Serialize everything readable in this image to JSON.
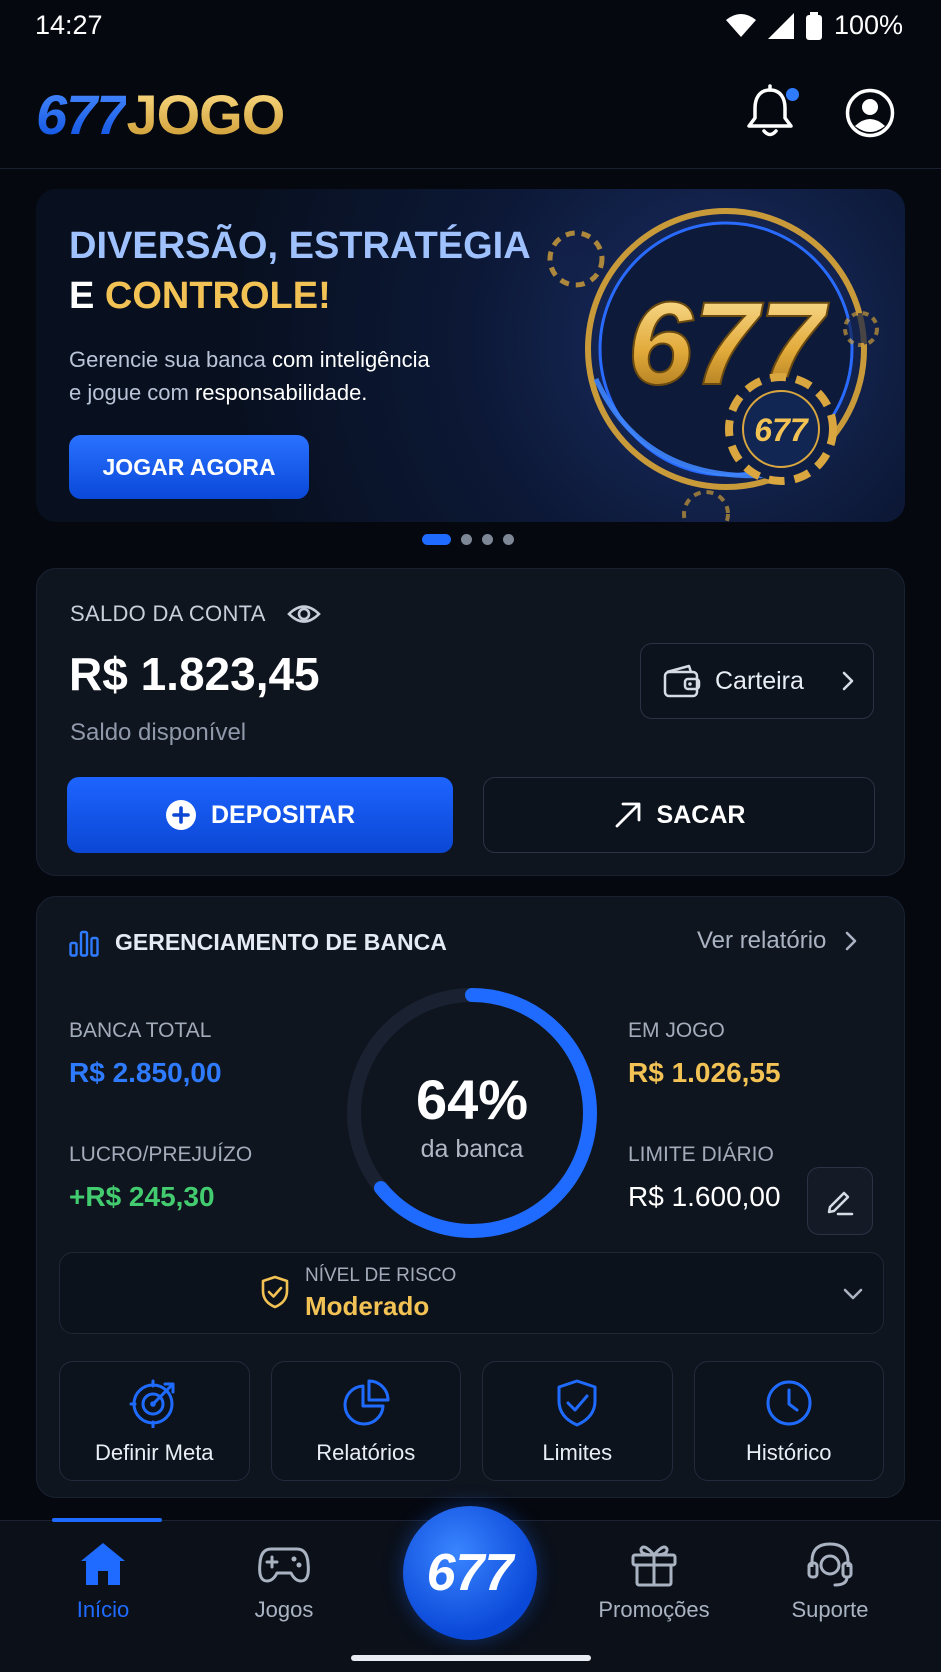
{
  "status_bar": {
    "time": "14:27",
    "battery": "100%"
  },
  "header": {
    "logo_number": "677",
    "logo_text": "JOGO",
    "has_notification": true
  },
  "hero": {
    "title_line1": "DIVERSÃO, ESTRATÉGIA",
    "title_line2_prefix": "E ",
    "title_line2_highlight": "CONTROLE!",
    "subtitle_a": "Gerencie sua banca ",
    "subtitle_b": "com inteligência",
    "subtitle_c": "e jogue com ",
    "subtitle_d": "responsabilidade.",
    "cta": "JOGAR AGORA",
    "art_number": "677",
    "chip_number": "677"
  },
  "carousel": {
    "total": 4,
    "active": 0
  },
  "balance": {
    "label": "SALDO DA CONTA",
    "amount": "R$ 1.823,45",
    "sublabel": "Saldo disponível",
    "wallet_label": "Carteira",
    "deposit_label": "DEPOSITAR",
    "withdraw_label": "SACAR"
  },
  "management": {
    "title": "GERENCIAMENTO DE BANCA",
    "report_link": "Ver relatório",
    "bank_total_label": "BANCA TOTAL",
    "bank_total_value": "R$ 2.850,00",
    "profit_label": "LUCRO/PREJUÍZO",
    "profit_value": "+R$ 245,30",
    "in_game_label": "EM JOGO",
    "in_game_value": "R$ 1.026,55",
    "daily_limit_label": "LIMITE DIÁRIO",
    "daily_limit_value": "R$ 1.600,00",
    "ring_percent_text": "64%",
    "ring_percent": 64,
    "ring_sub": "da banca",
    "risk_label": "NÍVEL DE RISCO",
    "risk_value": "Moderado",
    "tiles": [
      {
        "label": "Definir Meta",
        "icon": "target-icon"
      },
      {
        "label": "Relatórios",
        "icon": "pie-chart-icon"
      },
      {
        "label": "Limites",
        "icon": "shield-check-icon"
      },
      {
        "label": "Histórico",
        "icon": "clock-icon"
      }
    ]
  },
  "bottom_nav": {
    "items": [
      {
        "label": "Início",
        "icon": "home-icon",
        "active": true
      },
      {
        "label": "Jogos",
        "icon": "gamepad-icon",
        "active": false
      },
      {
        "label": "Promoções",
        "icon": "gift-icon",
        "active": false
      },
      {
        "label": "Suporte",
        "icon": "headset-icon",
        "active": false
      }
    ],
    "center_label": "677"
  },
  "colors": {
    "accent_blue": "#1f6bff",
    "gold": "#f2c255",
    "green": "#43cc6f",
    "background": "#05080f",
    "card": "#0f151f"
  }
}
